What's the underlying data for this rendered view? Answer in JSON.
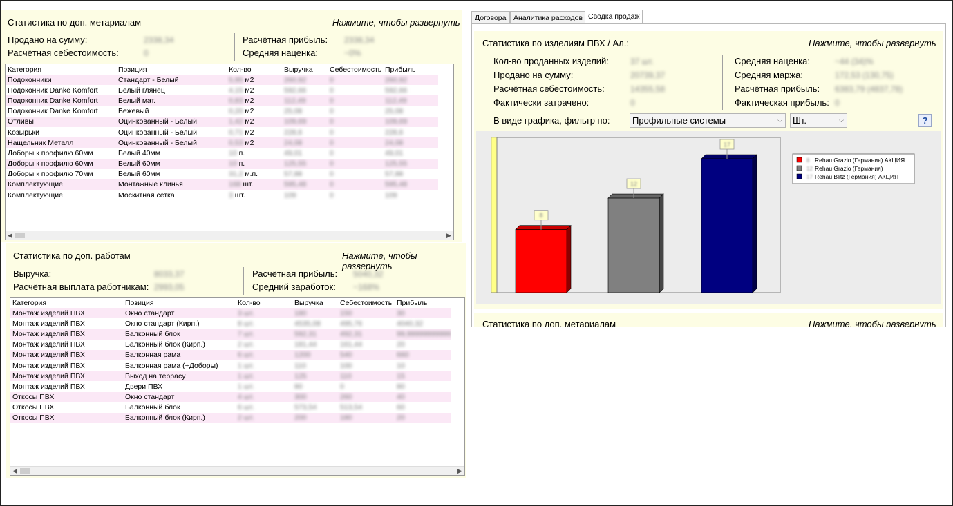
{
  "mat_panel": {
    "title": "Статистика по доп. метариалам",
    "expand": "Нажмите, чтобы развернуть",
    "sold_label": "Продано на сумму:",
    "sold_value": "2338,34",
    "cost_label": "Расчётная себестоимость:",
    "cost_value": "0",
    "profit_label": "Расчётная прибыль:",
    "profit_value": "2338,34",
    "markup_label": "Средняя наценка:",
    "markup_value": "~0%",
    "columns": [
      "Категория",
      "Позиция",
      "Кол-во",
      "Выручка",
      "Себестоимость",
      "Прибыль"
    ],
    "rows": [
      [
        "Подоконники",
        "Стандарт - Белый",
        "5,95",
        "м2",
        "260,92",
        "0",
        "260,92"
      ],
      [
        "Подоконник Danke Komfort",
        "Белый глянец",
        "4,15",
        "м2",
        "592,66",
        "0",
        "592,66"
      ],
      [
        "Подоконник Danke Komfort",
        "Белый мат.",
        "0,83",
        "м2",
        "112,49",
        "0",
        "112,49"
      ],
      [
        "Подоконник Danke Komfort",
        "Бежевый",
        "0,20",
        "м2",
        "25,08",
        "0",
        "25,08"
      ],
      [
        "Отливы",
        "Оцинкованный - Белый",
        "1,42",
        "м2",
        "109,69",
        "0",
        "109,69"
      ],
      [
        "Козырьки",
        "Оцинкованный - Белый",
        "0,71",
        "м2",
        "228,6",
        "0",
        "228,6"
      ],
      [
        "Нащельник Металл",
        "Оцинкованный - Белый",
        "0,53",
        "м2",
        "24,08",
        "0",
        "24,08"
      ],
      [
        "Доборы к профилю 60мм",
        "Белый 40мм",
        "10",
        "п.",
        "49,01",
        "0",
        "49,01"
      ],
      [
        "Доборы к профилю 60мм",
        "Белый 60мм",
        "10",
        "п.",
        "125,55",
        "0",
        "125,55"
      ],
      [
        "Доборы к профилю 70мм",
        "Белый 60мм",
        "31,2",
        "м.п.",
        "57,88",
        "0",
        "57,88"
      ],
      [
        "Комплектующие",
        "Монтажные клинья",
        "168",
        "шт.",
        "595,48",
        "0",
        "595,48"
      ],
      [
        "Комплектующие",
        "Москитная сетка",
        "3",
        "шт.",
        "109",
        "0",
        "109"
      ]
    ]
  },
  "work_panel": {
    "title": "Статистика по доп. работам",
    "expand": "Нажмите, чтобы развернуть",
    "revenue_label": "Выручка:",
    "revenue_value": "8033,37",
    "payout_label": "Расчётная выплата работникам:",
    "payout_value": "2993,05",
    "profit_label": "Расчётная прибыль:",
    "profit_value": "5040,32",
    "salary_label": "Средний заработок:",
    "salary_value": "~168%",
    "columns": [
      "Категория",
      "Позиция",
      "Кол-во",
      "Выручка",
      "Себестоимость",
      "Прибыль"
    ],
    "rows": [
      [
        "Монтаж изделий ПВХ",
        "Окно стандарт",
        "3 шт.",
        "180",
        "150",
        "30"
      ],
      [
        "Монтаж изделий ПВХ",
        "Окно стандарт (Кирп.)",
        "8 шт.",
        "4535,08",
        "495,76",
        "4040,32"
      ],
      [
        "Монтаж изделий ПВХ",
        "Балконный блок",
        "7 шт.",
        "592,31",
        "492,31",
        "99,99999999999"
      ],
      [
        "Монтаж изделий ПВХ",
        "Балконный блок (Кирп.)",
        "2 шт.",
        "181,44",
        "161,44",
        "20"
      ],
      [
        "Монтаж изделий ПВХ",
        "Балконная рама",
        "6 шт.",
        "1200",
        "540",
        "660"
      ],
      [
        "Монтаж изделий ПВХ",
        "Балконная рама (+Доборы)",
        "1 шт.",
        "110",
        "100",
        "10"
      ],
      [
        "Монтаж изделий ПВХ",
        "Выход на террасу",
        "1 шт.",
        "125",
        "110",
        "15"
      ],
      [
        "Монтаж изделий ПВХ",
        "Двери ПВХ",
        "1 шт.",
        "80",
        "0",
        "80"
      ],
      [
        "Откосы ПВХ",
        "Окно стандарт",
        "4 шт.",
        "300",
        "260",
        "40"
      ],
      [
        "Откосы ПВХ",
        "Балконный блок",
        "6 шт.",
        "573,54",
        "513,54",
        "60"
      ],
      [
        "Откосы ПВХ",
        "Балконный блок (Кирп.)",
        "2 шт.",
        "200",
        "180",
        "20"
      ]
    ]
  },
  "tabs": [
    "Договора",
    "Аналитика расходов",
    "Сводка продаж"
  ],
  "pvc_panel": {
    "title": "Статистика по изделиям ПВХ / Ал.:",
    "expand": "Нажмите, чтобы развернуть",
    "qty_label": "Кол-во проданных изделий:",
    "qty_value": "37 шт.",
    "sold_label": "Продано на сумму:",
    "sold_value": "20739,37",
    "cost_label": "Расчётная себестоимость:",
    "cost_value": "14355,58",
    "spent_label": "Фактически затрачено:",
    "spent_value": "0",
    "markup_label": "Средняя наценка:",
    "markup_value": "~44 (34)%",
    "margin_label": "Средняя маржа:",
    "margin_value": "172,53 (130,75)",
    "profit_label": "Расчётная прибыль:",
    "profit_value": "6383,79 (4837,78)",
    "fact_profit_label": "Фактическая прибыль:",
    "fact_profit_value": "0",
    "filter_label": "В виде графика, фильтр по:",
    "filter_value": "Профильные системы",
    "unit_value": "Шт.",
    "help_label": "?"
  },
  "chart_data": {
    "type": "bar",
    "categories": [
      "Rehau Grazio (Германия) АКЦИЯ",
      "Rehau Grazio (Германия)",
      "Rehau Blitz (Германия) АКЦИЯ"
    ],
    "values": [
      8,
      12,
      17
    ],
    "colors": [
      "#ff0000",
      "#808080",
      "#000080"
    ],
    "ylim": [
      0,
      17
    ],
    "legend": "top-right",
    "grid": false
  },
  "bottom_panel": {
    "title": "Статистика по доп. метариалам",
    "expand": "Нажмите, чтобы развернуть"
  }
}
